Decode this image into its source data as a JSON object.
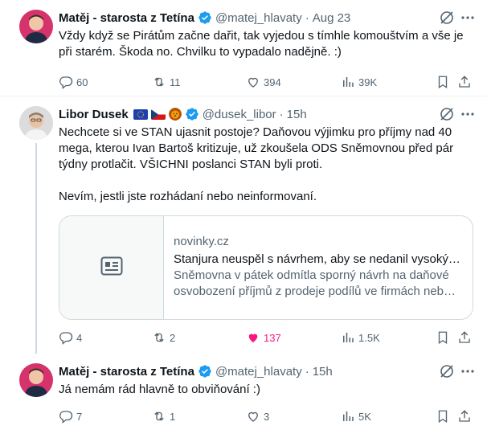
{
  "tweets": [
    {
      "name": "Matěj - starosta z Tetína",
      "handle": "@matej_hlavaty",
      "time": "Aug 23",
      "text": "Vždy když se Pirátům začne dařit, tak vyjedou s tímhle komouštvím a vše je při starém. Škoda no. Chvilku to vypadalo nadějně. :)",
      "replies": "60",
      "reposts": "11",
      "likes": "394",
      "views": "39K"
    },
    {
      "name": "Libor Dusek",
      "flags": [
        "eu-flag",
        "cz-flag",
        "lion-emoji"
      ],
      "handle": "@dusek_libor",
      "time": "15h",
      "text": "Nechcete si ve STAN ujasnit postoje? Daňovou výjimku pro příjmy nad 40 mega, kterou Ivan Bartoš kritizuje, už zkoušela ODS Sněmovnou před pár týdny protlačit. VŠICHNI poslanci STAN byli proti.\n\nNevím, jestli jste rozhádaní nebo neinformovaní.",
      "card": {
        "domain": "novinky.cz",
        "title": "Stanjura neuspěl s návrhem, aby se nedanil vysoký…",
        "description": "Sněmovna v pátek odmítla sporný návrh na daňové osvobození příjmů z prodeje podílů ve firmách neb…"
      },
      "replies": "4",
      "reposts": "2",
      "likes": "137",
      "views": "1.5K"
    },
    {
      "name": "Matěj - starosta z Tetína",
      "handle": "@matej_hlavaty",
      "time": "15h",
      "text": "Já nemám rád hlavně to obviňování :)",
      "replies": "7",
      "reposts": "1",
      "likes": "3",
      "views": "5K"
    }
  ],
  "colors": {
    "text": "#0f1419",
    "secondary": "#536471",
    "verified": "#1d9bf0",
    "like": "#f91880",
    "border": "#cfd9de"
  },
  "dot": "·"
}
